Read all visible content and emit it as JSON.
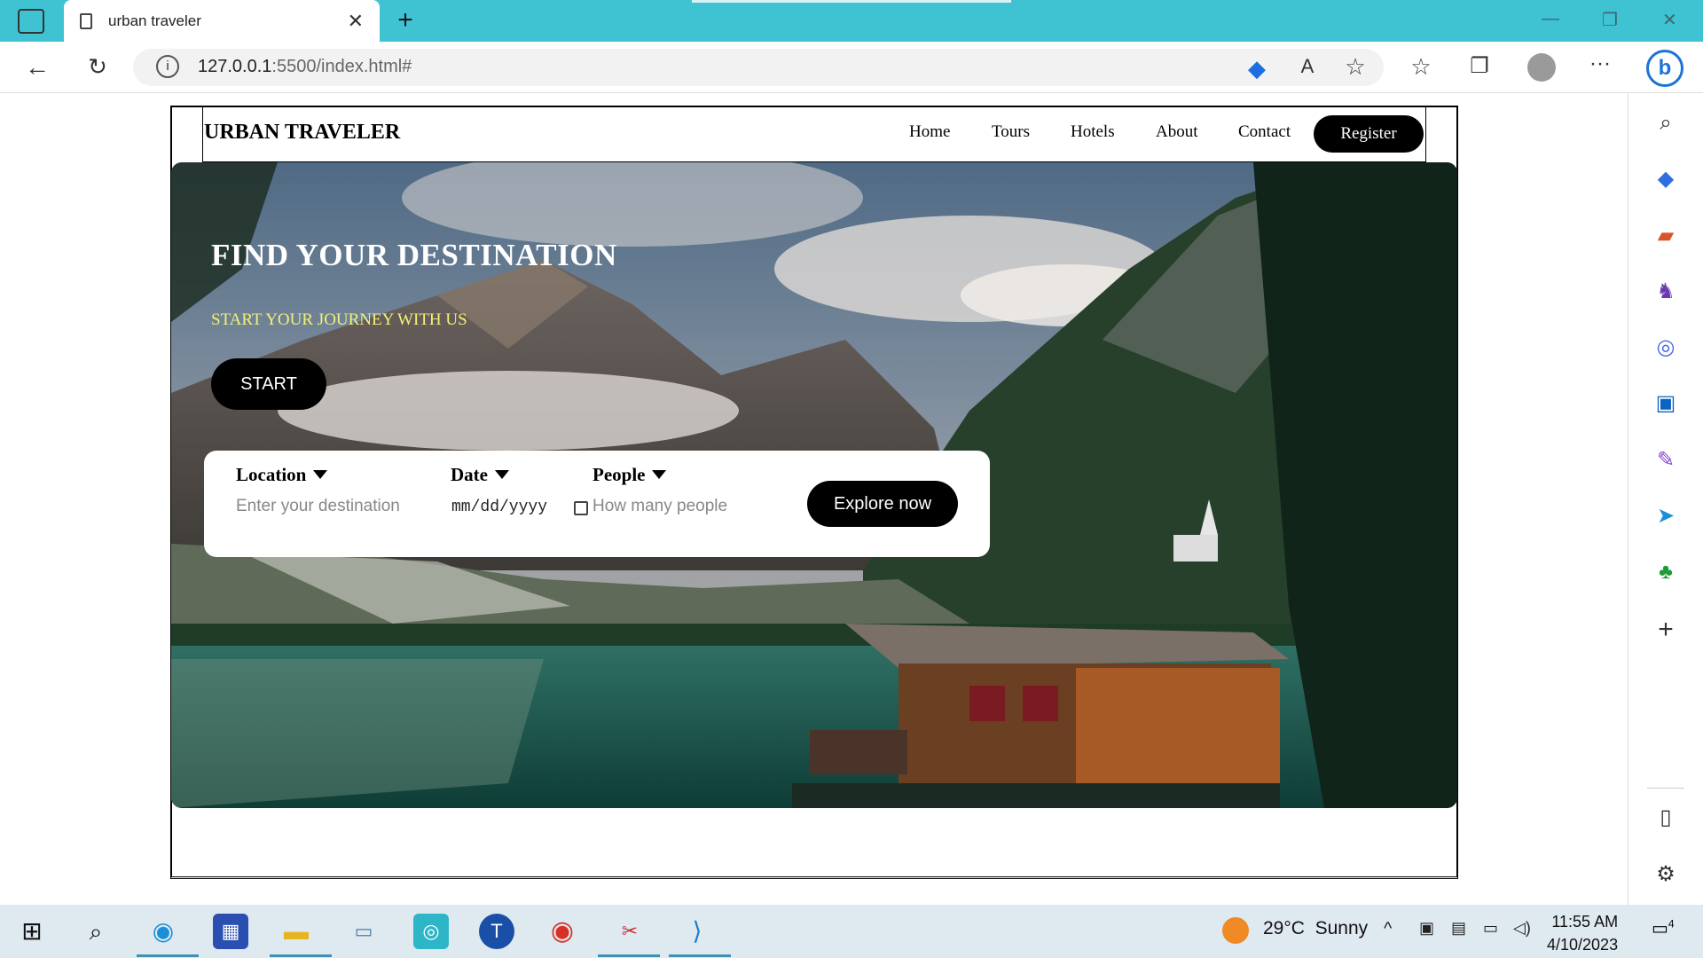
{
  "browser": {
    "tab_title": "urban traveler",
    "tab_close": "✕",
    "new_tab": "+",
    "url_host": "127.0.0.1",
    "url_rest": ":5500/index.html#",
    "window_controls": {
      "minimize": "—",
      "restore": "❐",
      "close": "✕"
    }
  },
  "site": {
    "logo": "URBAN TRAVELER",
    "nav": [
      "Home",
      "Tours",
      "Hotels",
      "About",
      "Contact"
    ],
    "register": "Register"
  },
  "hero": {
    "title": "FIND YOUR DESTINATION",
    "subtitle": "START YOUR JOURNEY WITH US",
    "start_button": "START"
  },
  "search": {
    "location_label": "Location",
    "location_placeholder": "Enter your destination",
    "date_label": "Date",
    "date_value": "mm/dd/yyyy",
    "people_label": "People",
    "people_placeholder": "How many people",
    "explore_button": "Explore now"
  },
  "taskbar": {
    "weather_temp": "29°C",
    "weather_desc": "Sunny",
    "time": "11:55 AM",
    "date": "4/10/2023",
    "notifications": "4"
  },
  "colors": {
    "tabbar": "#3fc3d3",
    "subtitle": "#f3f07a",
    "button": "#000000"
  }
}
